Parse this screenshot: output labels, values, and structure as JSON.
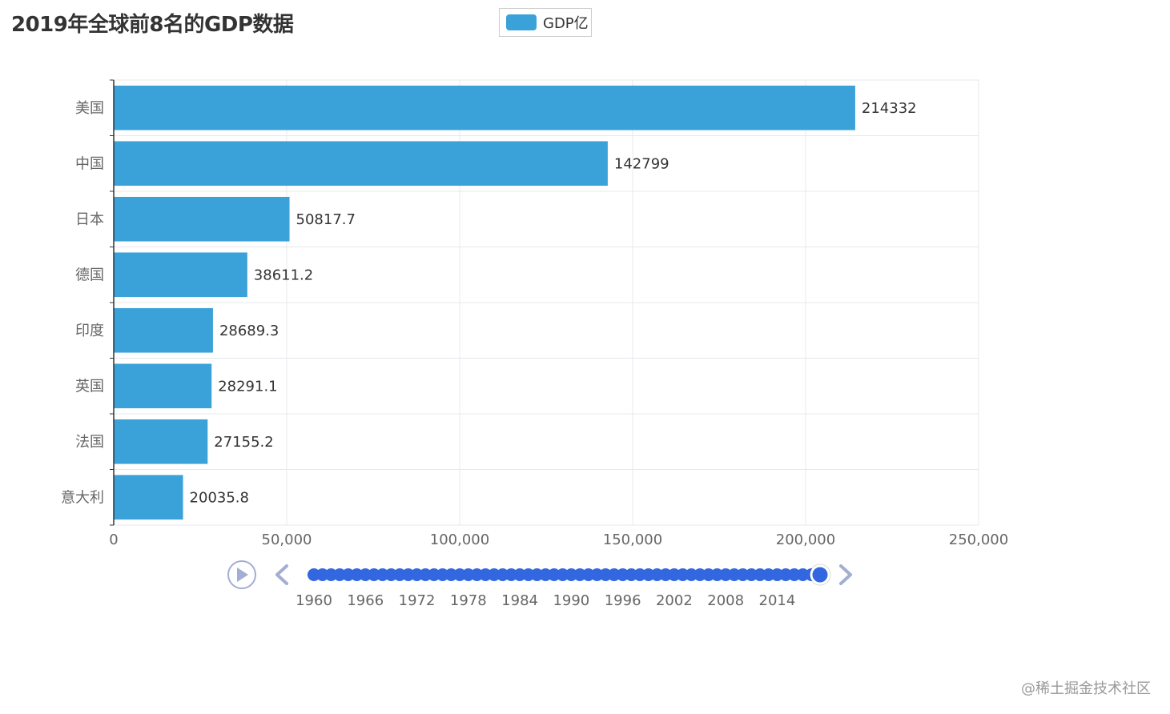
{
  "colors": {
    "bar": "#3aa1d9",
    "grid": "#e4e9ee",
    "axis": "#333333",
    "timeline_dot": "#3367e0",
    "timeline_control": "#a3aed3"
  },
  "chart_data": {
    "type": "bar",
    "orientation": "horizontal",
    "title": "2019年全球前8名的GDP数据",
    "legend": {
      "position": "top-center",
      "entries": [
        "GDP亿"
      ]
    },
    "categories": [
      "美国",
      "中国",
      "日本",
      "德国",
      "印度",
      "英国",
      "法国",
      "意大利"
    ],
    "series": [
      {
        "name": "GDP亿",
        "values": [
          214332,
          142799,
          50817.7,
          38611.2,
          28689.3,
          28291.1,
          27155.2,
          20035.8
        ],
        "labels": [
          "214332",
          "142799",
          "50817.7",
          "38611.2",
          "28689.3",
          "28291.1",
          "27155.2",
          "20035.8"
        ]
      }
    ],
    "xlim": [
      0,
      250000
    ],
    "x_ticks": [
      0,
      50000,
      100000,
      150000,
      200000,
      250000
    ],
    "x_tick_labels": [
      "0",
      "50,000",
      "100,000",
      "150,000",
      "200,000",
      "250,000"
    ],
    "grid": true
  },
  "timeline": {
    "labels": [
      "1960",
      "1966",
      "1972",
      "1978",
      "1984",
      "1990",
      "1996",
      "2002",
      "2008",
      "2014"
    ],
    "start_year": 1960,
    "end_year": 2019,
    "current": 2019,
    "play_icon": "play-icon",
    "prev_icon": "chevron-left-icon",
    "next_icon": "chevron-right-icon"
  },
  "watermark": "@稀土掘金技术社区"
}
